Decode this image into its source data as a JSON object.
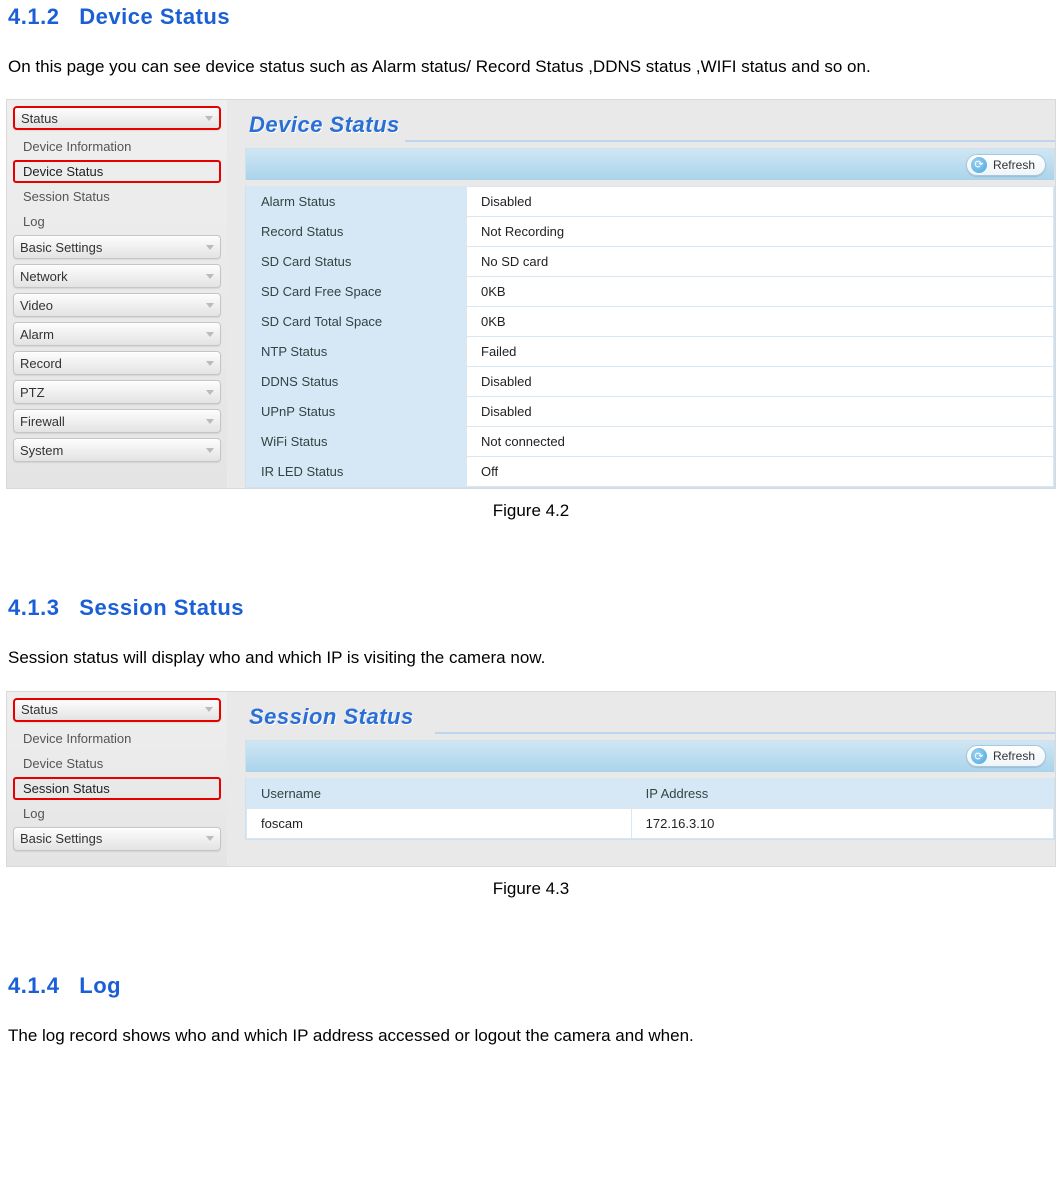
{
  "section_412": {
    "number": "4.1.2",
    "title": "Device Status",
    "paragraph": "On this page you can see device status such as Alarm status/ Record Status ,DDNS status ,WIFI status and so on."
  },
  "figure42": {
    "caption": "Figure 4.2",
    "sidebar": {
      "top_item": "Status",
      "subs": [
        "Device Information",
        "Device Status",
        "Session Status",
        "Log"
      ],
      "highlight_index": 1,
      "sections": [
        "Basic Settings",
        "Network",
        "Video",
        "Alarm",
        "Record",
        "PTZ",
        "Firewall",
        "System"
      ]
    },
    "panel_title": "Device Status",
    "refresh_label": "Refresh",
    "rows": [
      {
        "label": "Alarm Status",
        "value": "Disabled"
      },
      {
        "label": "Record Status",
        "value": "Not Recording"
      },
      {
        "label": "SD Card Status",
        "value": "No SD card"
      },
      {
        "label": "SD Card Free Space",
        "value": "0KB"
      },
      {
        "label": "SD Card Total Space",
        "value": "0KB"
      },
      {
        "label": "NTP Status",
        "value": "Failed"
      },
      {
        "label": "DDNS Status",
        "value": "Disabled"
      },
      {
        "label": "UPnP Status",
        "value": "Disabled"
      },
      {
        "label": "WiFi Status",
        "value": "Not connected"
      },
      {
        "label": "IR LED Status",
        "value": "Off"
      }
    ]
  },
  "section_413": {
    "number": "4.1.3",
    "title": "Session Status",
    "paragraph": "Session status will display who and which IP is visiting the camera now."
  },
  "figure43": {
    "caption": "Figure 4.3",
    "sidebar": {
      "top_item": "Status",
      "subs": [
        "Device Information",
        "Device Status",
        "Session Status",
        "Log"
      ],
      "highlight_index": 2,
      "sections": [
        "Basic Settings"
      ]
    },
    "panel_title": "Session Status",
    "refresh_label": "Refresh",
    "columns": [
      "Username",
      "IP Address"
    ],
    "rows": [
      {
        "username": "foscam",
        "ip": "172.16.3.10"
      }
    ]
  },
  "section_414": {
    "number": "4.1.4",
    "title": "Log",
    "paragraph": "The log record shows who and which IP address accessed or logout the camera and when."
  }
}
